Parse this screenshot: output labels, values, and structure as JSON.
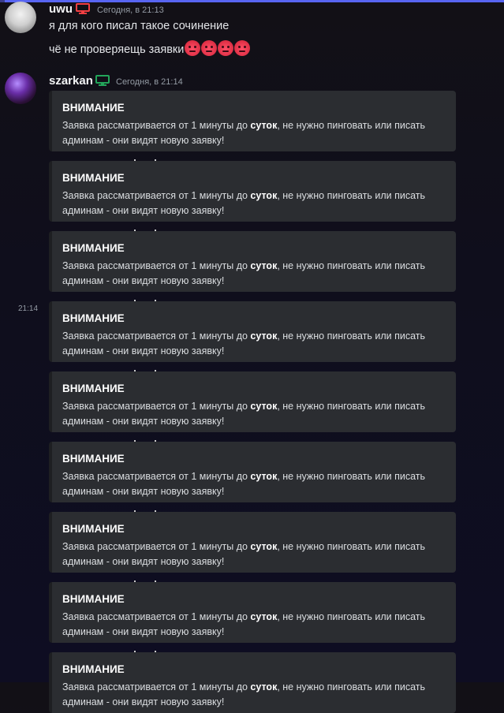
{
  "messages": [
    {
      "author": "uwu",
      "time": "Сегодня, в 21:13",
      "lines": [
        "я для кого писал такое сочинение",
        "чё не проверяещь заявки"
      ],
      "emoji_count": 4,
      "emoji_name": "rage-emoji"
    },
    {
      "author": "szarkan",
      "time": "Сегодня, в 21:14",
      "side_time": "21:14",
      "embed": {
        "title": "ВНИМАНИЕ",
        "text_before": "Заявка рассматривается от 1 минуты до ",
        "text_bold": "суток",
        "text_after": ", не нужно пинговать или писать админам - они видят новую заявку!"
      },
      "embed_repeat_count": 9
    }
  ],
  "colors": {
    "accent": "#5865f2",
    "embed_bg": "#2b2d31",
    "uwu_device": "#f23f43",
    "szarkan_device": "#23a55a"
  }
}
